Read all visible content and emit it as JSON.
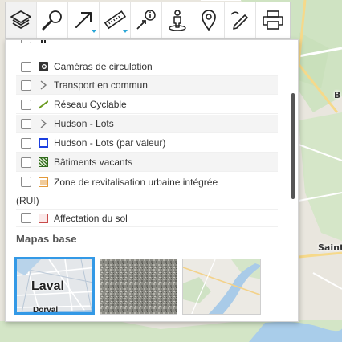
{
  "map": {
    "label_right_top": "B",
    "label_right_mid": "Saint-"
  },
  "toolbar": {
    "tools": [
      {
        "name": "layers-icon",
        "active": true
      },
      {
        "name": "search-icon"
      },
      {
        "name": "navigate-arrow-icon",
        "has_dropdown": true
      },
      {
        "name": "ruler-icon",
        "has_dropdown": true
      },
      {
        "name": "info-pointer-icon"
      },
      {
        "name": "street-view-icon"
      },
      {
        "name": "map-pin-icon"
      },
      {
        "name": "draw-pencil-icon"
      },
      {
        "name": "print-icon"
      }
    ]
  },
  "layers": [
    {
      "label": "Caméras de circulation",
      "icon": "camera-icon",
      "checked": false
    },
    {
      "label": "Transport en commun",
      "icon": "expand-arrow-icon",
      "checked": false
    },
    {
      "label": "Réseau Cyclable",
      "icon": "green-line-icon",
      "checked": false
    },
    {
      "label": "Hudson - Lots",
      "icon": "expand-arrow-icon",
      "checked": false
    },
    {
      "label": "Hudson - Lots (par valeur)",
      "icon": "blue-square-icon",
      "checked": false
    },
    {
      "label": "Bâtiments vacants",
      "icon": "green-hatch-icon",
      "checked": false
    },
    {
      "label": "Zone de revitalisation urbaine intégrée",
      "label_tail": "(RUI)",
      "icon": "orange-hatch-icon",
      "checked": false
    },
    {
      "label": "Affectation du sol",
      "icon": "red-square-icon",
      "checked": false
    }
  ],
  "basemaps": {
    "title": "Mapas base",
    "items": [
      {
        "label": "Laval",
        "sublabel": "Dorval",
        "selected": true
      },
      {
        "label": "",
        "selected": false
      },
      {
        "label": "",
        "selected": false
      }
    ]
  },
  "colors": {
    "accent": "#2aa6d6",
    "selected_border": "#3399e6"
  }
}
